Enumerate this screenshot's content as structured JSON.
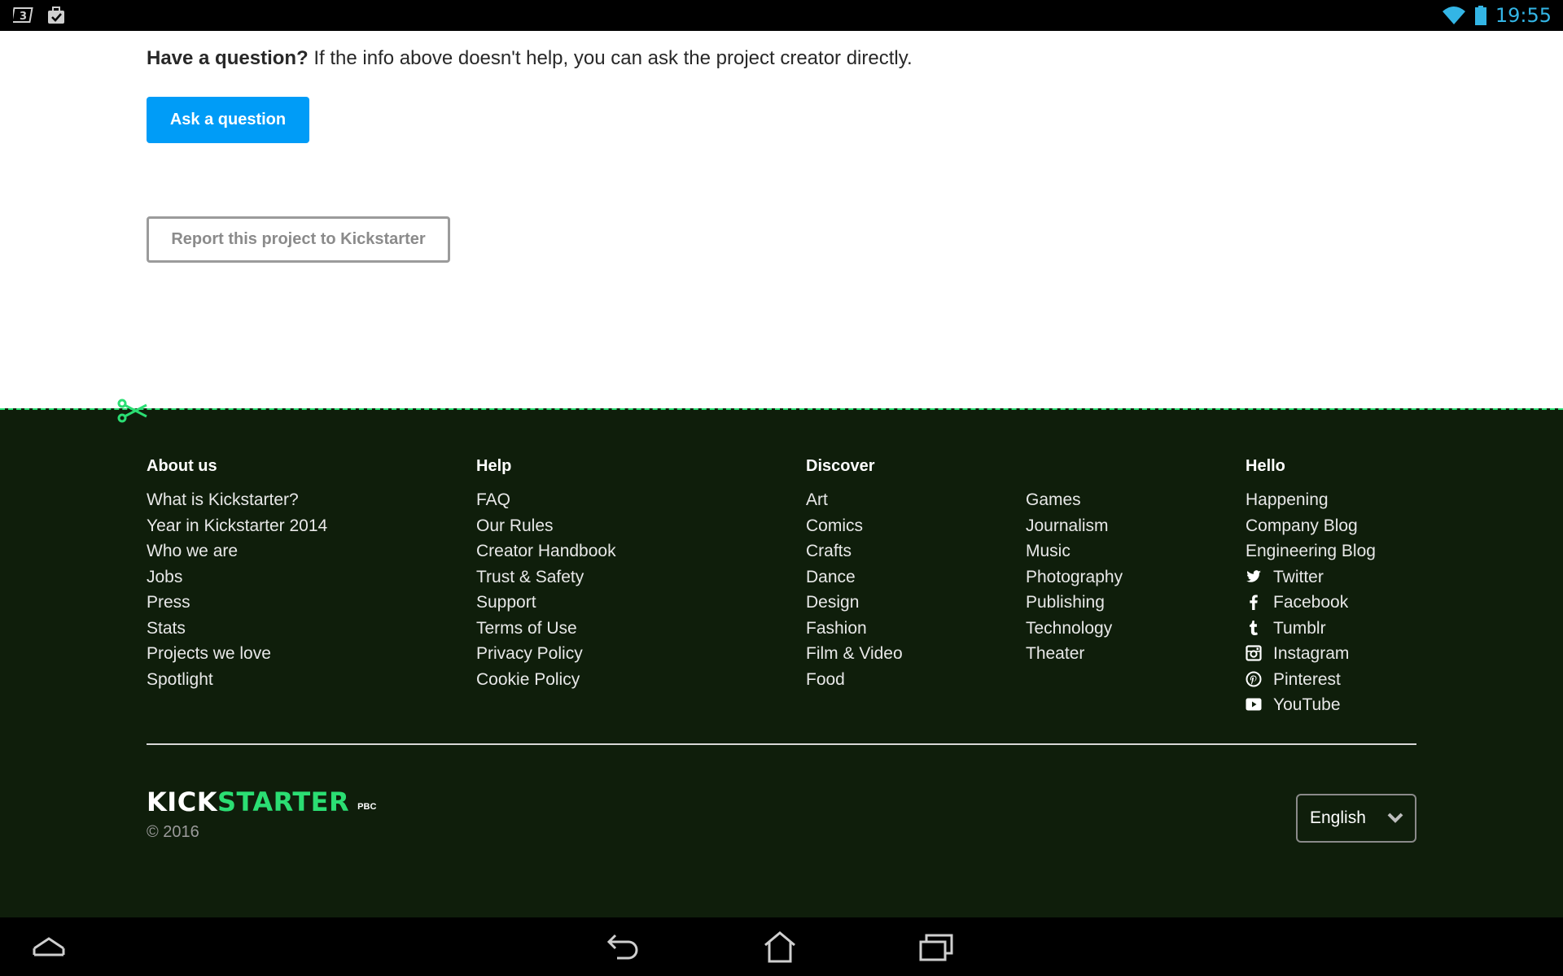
{
  "status_bar": {
    "time": "19:55",
    "left_icons": [
      "sim-3g-icon",
      "task-icon"
    ],
    "right_icons": [
      "wifi-icon",
      "battery-icon"
    ]
  },
  "main": {
    "question_bold": "Have a question?",
    "question_text": " If the info above doesn't help, you can ask the project creator directly.",
    "ask_button": "Ask a question",
    "report_button": "Report this project to Kickstarter"
  },
  "footer": {
    "about": {
      "title": "About us",
      "items": [
        "What is Kickstarter?",
        "Year in Kickstarter 2014",
        "Who we are",
        "Jobs",
        "Press",
        "Stats",
        "Projects we love",
        "Spotlight"
      ]
    },
    "help": {
      "title": "Help",
      "items": [
        "FAQ",
        "Our Rules",
        "Creator Handbook",
        "Trust & Safety",
        "Support",
        "Terms of Use",
        "Privacy Policy",
        "Cookie Policy"
      ]
    },
    "discover": {
      "title": "Discover",
      "items_col1": [
        "Art",
        "Comics",
        "Crafts",
        "Dance",
        "Design",
        "Fashion",
        "Film & Video",
        "Food"
      ],
      "items_col2": [
        "Games",
        "Journalism",
        "Music",
        "Photography",
        "Publishing",
        "Technology",
        "Theater"
      ]
    },
    "hello": {
      "title": "Hello",
      "items": [
        "Happening",
        "Company Blog",
        "Engineering Blog"
      ],
      "social": [
        {
          "label": "Twitter",
          "icon": "twitter-icon"
        },
        {
          "label": "Facebook",
          "icon": "facebook-icon"
        },
        {
          "label": "Tumblr",
          "icon": "tumblr-icon"
        },
        {
          "label": "Instagram",
          "icon": "instagram-icon"
        },
        {
          "label": "Pinterest",
          "icon": "pinterest-icon"
        },
        {
          "label": "YouTube",
          "icon": "youtube-icon"
        }
      ]
    },
    "logo_kick": "KICK",
    "logo_starter": "STARTER",
    "logo_pbc": "PBC",
    "copyright": "© 2016",
    "language": "English"
  },
  "colors": {
    "accent_blue": "#009cf7",
    "kickstarter_green": "#2bde73",
    "footer_bg": "#0f1e0b",
    "status_blue": "#33b5e5"
  }
}
